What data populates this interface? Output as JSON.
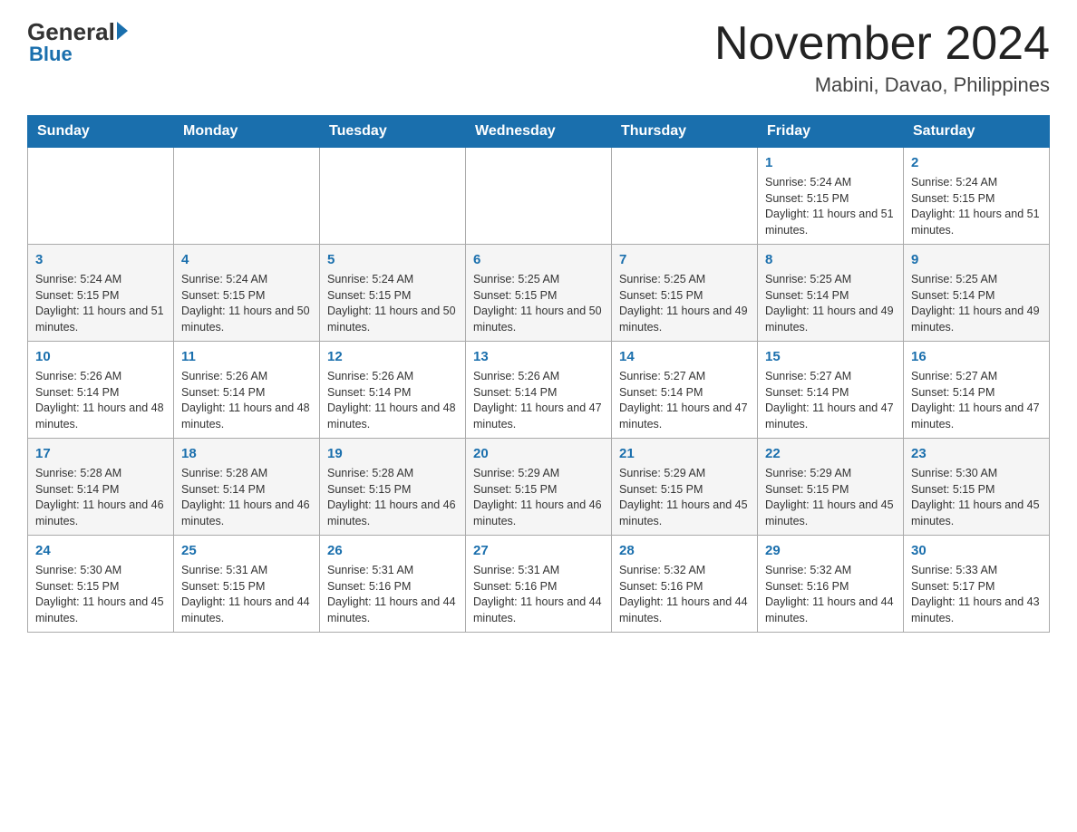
{
  "header": {
    "logo": {
      "general": "General",
      "blue": "Blue"
    },
    "title": "November 2024",
    "location": "Mabini, Davao, Philippines"
  },
  "calendar": {
    "days_of_week": [
      "Sunday",
      "Monday",
      "Tuesday",
      "Wednesday",
      "Thursday",
      "Friday",
      "Saturday"
    ],
    "weeks": [
      [
        {
          "day": "",
          "info": ""
        },
        {
          "day": "",
          "info": ""
        },
        {
          "day": "",
          "info": ""
        },
        {
          "day": "",
          "info": ""
        },
        {
          "day": "",
          "info": ""
        },
        {
          "day": "1",
          "info": "Sunrise: 5:24 AM\nSunset: 5:15 PM\nDaylight: 11 hours and 51 minutes."
        },
        {
          "day": "2",
          "info": "Sunrise: 5:24 AM\nSunset: 5:15 PM\nDaylight: 11 hours and 51 minutes."
        }
      ],
      [
        {
          "day": "3",
          "info": "Sunrise: 5:24 AM\nSunset: 5:15 PM\nDaylight: 11 hours and 51 minutes."
        },
        {
          "day": "4",
          "info": "Sunrise: 5:24 AM\nSunset: 5:15 PM\nDaylight: 11 hours and 50 minutes."
        },
        {
          "day": "5",
          "info": "Sunrise: 5:24 AM\nSunset: 5:15 PM\nDaylight: 11 hours and 50 minutes."
        },
        {
          "day": "6",
          "info": "Sunrise: 5:25 AM\nSunset: 5:15 PM\nDaylight: 11 hours and 50 minutes."
        },
        {
          "day": "7",
          "info": "Sunrise: 5:25 AM\nSunset: 5:15 PM\nDaylight: 11 hours and 49 minutes."
        },
        {
          "day": "8",
          "info": "Sunrise: 5:25 AM\nSunset: 5:14 PM\nDaylight: 11 hours and 49 minutes."
        },
        {
          "day": "9",
          "info": "Sunrise: 5:25 AM\nSunset: 5:14 PM\nDaylight: 11 hours and 49 minutes."
        }
      ],
      [
        {
          "day": "10",
          "info": "Sunrise: 5:26 AM\nSunset: 5:14 PM\nDaylight: 11 hours and 48 minutes."
        },
        {
          "day": "11",
          "info": "Sunrise: 5:26 AM\nSunset: 5:14 PM\nDaylight: 11 hours and 48 minutes."
        },
        {
          "day": "12",
          "info": "Sunrise: 5:26 AM\nSunset: 5:14 PM\nDaylight: 11 hours and 48 minutes."
        },
        {
          "day": "13",
          "info": "Sunrise: 5:26 AM\nSunset: 5:14 PM\nDaylight: 11 hours and 47 minutes."
        },
        {
          "day": "14",
          "info": "Sunrise: 5:27 AM\nSunset: 5:14 PM\nDaylight: 11 hours and 47 minutes."
        },
        {
          "day": "15",
          "info": "Sunrise: 5:27 AM\nSunset: 5:14 PM\nDaylight: 11 hours and 47 minutes."
        },
        {
          "day": "16",
          "info": "Sunrise: 5:27 AM\nSunset: 5:14 PM\nDaylight: 11 hours and 47 minutes."
        }
      ],
      [
        {
          "day": "17",
          "info": "Sunrise: 5:28 AM\nSunset: 5:14 PM\nDaylight: 11 hours and 46 minutes."
        },
        {
          "day": "18",
          "info": "Sunrise: 5:28 AM\nSunset: 5:14 PM\nDaylight: 11 hours and 46 minutes."
        },
        {
          "day": "19",
          "info": "Sunrise: 5:28 AM\nSunset: 5:15 PM\nDaylight: 11 hours and 46 minutes."
        },
        {
          "day": "20",
          "info": "Sunrise: 5:29 AM\nSunset: 5:15 PM\nDaylight: 11 hours and 46 minutes."
        },
        {
          "day": "21",
          "info": "Sunrise: 5:29 AM\nSunset: 5:15 PM\nDaylight: 11 hours and 45 minutes."
        },
        {
          "day": "22",
          "info": "Sunrise: 5:29 AM\nSunset: 5:15 PM\nDaylight: 11 hours and 45 minutes."
        },
        {
          "day": "23",
          "info": "Sunrise: 5:30 AM\nSunset: 5:15 PM\nDaylight: 11 hours and 45 minutes."
        }
      ],
      [
        {
          "day": "24",
          "info": "Sunrise: 5:30 AM\nSunset: 5:15 PM\nDaylight: 11 hours and 45 minutes."
        },
        {
          "day": "25",
          "info": "Sunrise: 5:31 AM\nSunset: 5:15 PM\nDaylight: 11 hours and 44 minutes."
        },
        {
          "day": "26",
          "info": "Sunrise: 5:31 AM\nSunset: 5:16 PM\nDaylight: 11 hours and 44 minutes."
        },
        {
          "day": "27",
          "info": "Sunrise: 5:31 AM\nSunset: 5:16 PM\nDaylight: 11 hours and 44 minutes."
        },
        {
          "day": "28",
          "info": "Sunrise: 5:32 AM\nSunset: 5:16 PM\nDaylight: 11 hours and 44 minutes."
        },
        {
          "day": "29",
          "info": "Sunrise: 5:32 AM\nSunset: 5:16 PM\nDaylight: 11 hours and 44 minutes."
        },
        {
          "day": "30",
          "info": "Sunrise: 5:33 AM\nSunset: 5:17 PM\nDaylight: 11 hours and 43 minutes."
        }
      ]
    ]
  }
}
